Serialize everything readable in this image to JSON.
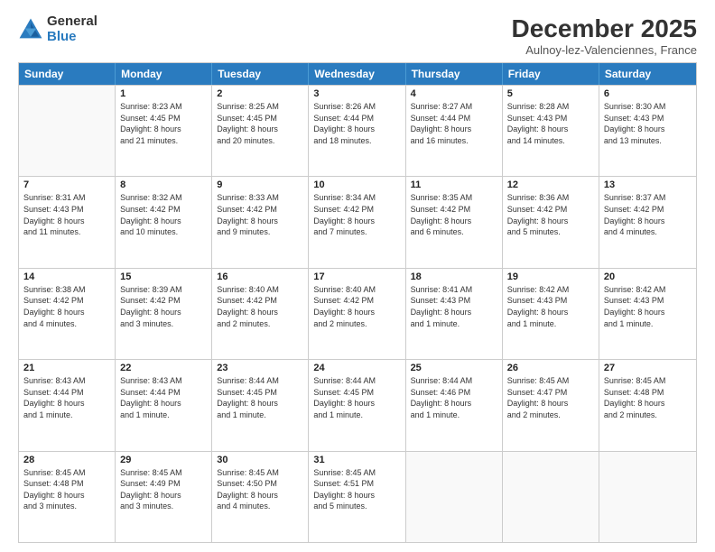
{
  "logo": {
    "general": "General",
    "blue": "Blue"
  },
  "header": {
    "month": "December 2025",
    "location": "Aulnoy-lez-Valenciennes, France"
  },
  "days_of_week": [
    "Sunday",
    "Monday",
    "Tuesday",
    "Wednesday",
    "Thursday",
    "Friday",
    "Saturday"
  ],
  "weeks": [
    [
      {
        "day": "",
        "info": ""
      },
      {
        "day": "1",
        "info": "Sunrise: 8:23 AM\nSunset: 4:45 PM\nDaylight: 8 hours\nand 21 minutes."
      },
      {
        "day": "2",
        "info": "Sunrise: 8:25 AM\nSunset: 4:45 PM\nDaylight: 8 hours\nand 20 minutes."
      },
      {
        "day": "3",
        "info": "Sunrise: 8:26 AM\nSunset: 4:44 PM\nDaylight: 8 hours\nand 18 minutes."
      },
      {
        "day": "4",
        "info": "Sunrise: 8:27 AM\nSunset: 4:44 PM\nDaylight: 8 hours\nand 16 minutes."
      },
      {
        "day": "5",
        "info": "Sunrise: 8:28 AM\nSunset: 4:43 PM\nDaylight: 8 hours\nand 14 minutes."
      },
      {
        "day": "6",
        "info": "Sunrise: 8:30 AM\nSunset: 4:43 PM\nDaylight: 8 hours\nand 13 minutes."
      }
    ],
    [
      {
        "day": "7",
        "info": "Sunrise: 8:31 AM\nSunset: 4:43 PM\nDaylight: 8 hours\nand 11 minutes."
      },
      {
        "day": "8",
        "info": "Sunrise: 8:32 AM\nSunset: 4:42 PM\nDaylight: 8 hours\nand 10 minutes."
      },
      {
        "day": "9",
        "info": "Sunrise: 8:33 AM\nSunset: 4:42 PM\nDaylight: 8 hours\nand 9 minutes."
      },
      {
        "day": "10",
        "info": "Sunrise: 8:34 AM\nSunset: 4:42 PM\nDaylight: 8 hours\nand 7 minutes."
      },
      {
        "day": "11",
        "info": "Sunrise: 8:35 AM\nSunset: 4:42 PM\nDaylight: 8 hours\nand 6 minutes."
      },
      {
        "day": "12",
        "info": "Sunrise: 8:36 AM\nSunset: 4:42 PM\nDaylight: 8 hours\nand 5 minutes."
      },
      {
        "day": "13",
        "info": "Sunrise: 8:37 AM\nSunset: 4:42 PM\nDaylight: 8 hours\nand 4 minutes."
      }
    ],
    [
      {
        "day": "14",
        "info": "Sunrise: 8:38 AM\nSunset: 4:42 PM\nDaylight: 8 hours\nand 4 minutes."
      },
      {
        "day": "15",
        "info": "Sunrise: 8:39 AM\nSunset: 4:42 PM\nDaylight: 8 hours\nand 3 minutes."
      },
      {
        "day": "16",
        "info": "Sunrise: 8:40 AM\nSunset: 4:42 PM\nDaylight: 8 hours\nand 2 minutes."
      },
      {
        "day": "17",
        "info": "Sunrise: 8:40 AM\nSunset: 4:42 PM\nDaylight: 8 hours\nand 2 minutes."
      },
      {
        "day": "18",
        "info": "Sunrise: 8:41 AM\nSunset: 4:43 PM\nDaylight: 8 hours\nand 1 minute."
      },
      {
        "day": "19",
        "info": "Sunrise: 8:42 AM\nSunset: 4:43 PM\nDaylight: 8 hours\nand 1 minute."
      },
      {
        "day": "20",
        "info": "Sunrise: 8:42 AM\nSunset: 4:43 PM\nDaylight: 8 hours\nand 1 minute."
      }
    ],
    [
      {
        "day": "21",
        "info": "Sunrise: 8:43 AM\nSunset: 4:44 PM\nDaylight: 8 hours\nand 1 minute."
      },
      {
        "day": "22",
        "info": "Sunrise: 8:43 AM\nSunset: 4:44 PM\nDaylight: 8 hours\nand 1 minute."
      },
      {
        "day": "23",
        "info": "Sunrise: 8:44 AM\nSunset: 4:45 PM\nDaylight: 8 hours\nand 1 minute."
      },
      {
        "day": "24",
        "info": "Sunrise: 8:44 AM\nSunset: 4:45 PM\nDaylight: 8 hours\nand 1 minute."
      },
      {
        "day": "25",
        "info": "Sunrise: 8:44 AM\nSunset: 4:46 PM\nDaylight: 8 hours\nand 1 minute."
      },
      {
        "day": "26",
        "info": "Sunrise: 8:45 AM\nSunset: 4:47 PM\nDaylight: 8 hours\nand 2 minutes."
      },
      {
        "day": "27",
        "info": "Sunrise: 8:45 AM\nSunset: 4:48 PM\nDaylight: 8 hours\nand 2 minutes."
      }
    ],
    [
      {
        "day": "28",
        "info": "Sunrise: 8:45 AM\nSunset: 4:48 PM\nDaylight: 8 hours\nand 3 minutes."
      },
      {
        "day": "29",
        "info": "Sunrise: 8:45 AM\nSunset: 4:49 PM\nDaylight: 8 hours\nand 3 minutes."
      },
      {
        "day": "30",
        "info": "Sunrise: 8:45 AM\nSunset: 4:50 PM\nDaylight: 8 hours\nand 4 minutes."
      },
      {
        "day": "31",
        "info": "Sunrise: 8:45 AM\nSunset: 4:51 PM\nDaylight: 8 hours\nand 5 minutes."
      },
      {
        "day": "",
        "info": ""
      },
      {
        "day": "",
        "info": ""
      },
      {
        "day": "",
        "info": ""
      }
    ]
  ]
}
